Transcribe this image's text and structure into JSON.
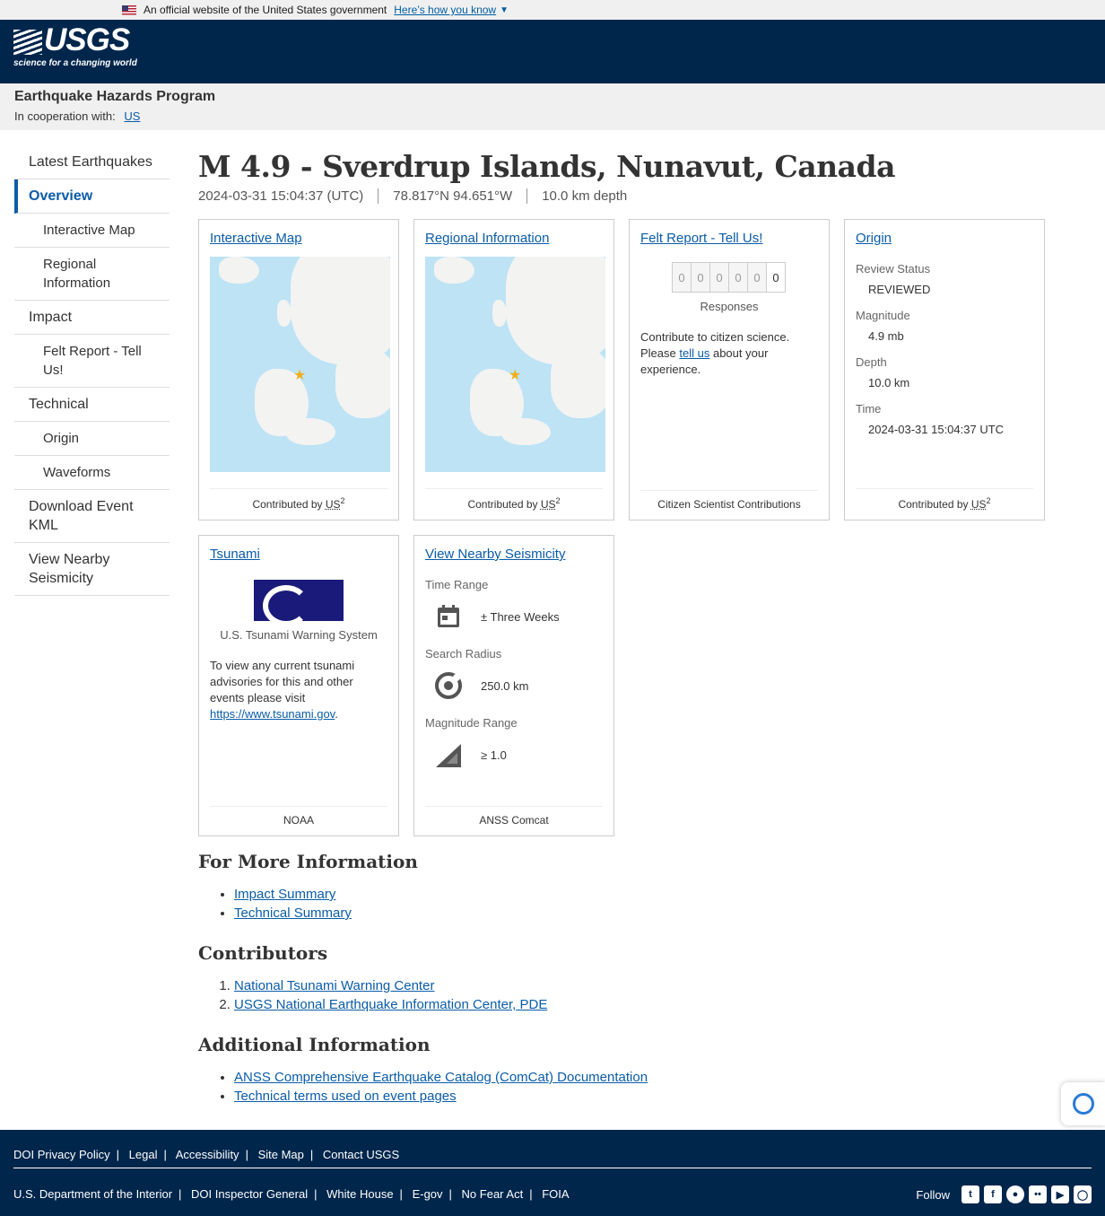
{
  "gov_banner": {
    "text": "An official website of the United States government",
    "link": "Here’s how you know"
  },
  "header": {
    "logo": "USGS",
    "tagline": "science for a changing world"
  },
  "program": {
    "title": "Earthquake Hazards Program",
    "coop_label": "In cooperation with:",
    "coop_link": "US"
  },
  "sidebar": {
    "items": [
      {
        "label": "Latest Earthquakes"
      },
      {
        "label": "Overview"
      },
      {
        "label": "Interactive Map"
      },
      {
        "label": "Regional Information"
      },
      {
        "label": "Impact"
      },
      {
        "label": "Felt Report - Tell Us!"
      },
      {
        "label": "Technical"
      },
      {
        "label": "Origin"
      },
      {
        "label": "Waveforms"
      },
      {
        "label": "Download Event KML"
      },
      {
        "label": "View Nearby Seismicity"
      }
    ]
  },
  "event": {
    "title": "M 4.9 - Sverdrup Islands, Nunavut, Canada",
    "time": "2024-03-31 15:04:37 (UTC)",
    "location": "78.817°N 94.651°W",
    "depth": "10.0 km depth"
  },
  "cards": {
    "interactive_map": {
      "title": "Interactive Map",
      "footer": "Contributed by",
      "contrib": "US",
      "count": "2"
    },
    "regional": {
      "title": "Regional Information",
      "footer": "Contributed by",
      "contrib": "US",
      "count": "2"
    },
    "felt": {
      "title": "Felt Report - Tell Us!",
      "digits": [
        "0",
        "0",
        "0",
        "0",
        "0",
        "0"
      ],
      "responses": "Responses",
      "text_before": "Contribute to citizen science. Please",
      "link": "tell us",
      "text_after": "about your experience.",
      "footer": "Citizen Scientist Contributions"
    },
    "origin": {
      "title": "Origin",
      "review_label": "Review Status",
      "review_value": "REVIEWED",
      "mag_label": "Magnitude",
      "mag_value": "4.9 mb",
      "depth_label": "Depth",
      "depth_value": "10.0 km",
      "time_label": "Time",
      "time_value": "2024-03-31 15:04:37 UTC",
      "footer": "Contributed by",
      "contrib": "US",
      "count": "2"
    },
    "tsunami": {
      "title": "Tsunami",
      "caption": "U.S. Tsunami Warning System",
      "text": "To view any current tsunami advisories for this and other events please visit",
      "link": "https://www.tsunami.gov",
      "footer": "NOAA"
    },
    "nearby": {
      "title": "View Nearby Seismicity",
      "time_label": "Time Range",
      "time_value": "± Three Weeks",
      "radius_label": "Search Radius",
      "radius_value": "250.0 km",
      "mag_label": "Magnitude Range",
      "mag_value": "≥ 1.0",
      "footer": "ANSS Comcat"
    }
  },
  "more_info": {
    "heading": "For More Information",
    "links": [
      "Impact Summary",
      "Technical Summary"
    ]
  },
  "contributors": {
    "heading": "Contributors",
    "links": [
      "National Tsunami Warning Center",
      "USGS National Earthquake Information Center, PDE"
    ]
  },
  "additional": {
    "heading": "Additional Information",
    "links": [
      "ANSS Comprehensive Earthquake Catalog (ComCat) Documentation",
      "Technical terms used on event pages"
    ]
  },
  "footer": {
    "row1": [
      "DOI Privacy Policy",
      "Legal",
      "Accessibility",
      "Site Map",
      "Contact USGS"
    ],
    "row2": [
      "U.S. Department of the Interior",
      "DOI Inspector General",
      "White House",
      "E-gov",
      "No Fear Act",
      "FOIA"
    ],
    "follow": "Follow",
    "social": [
      "twitter-icon",
      "facebook-icon",
      "github-icon",
      "flickr-icon",
      "youtube-icon",
      "instagram-icon"
    ]
  }
}
